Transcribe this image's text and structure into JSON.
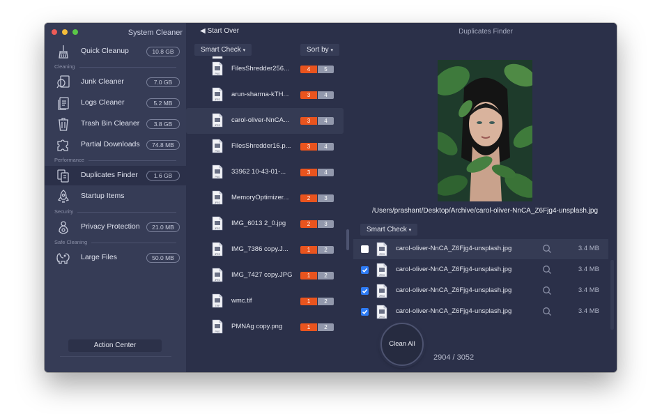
{
  "app": {
    "title": "System Cleaner",
    "window_title": "Duplicates Finder"
  },
  "sidebar": {
    "items": [
      {
        "label": "Quick Cleanup",
        "size": "10.8 GB",
        "icon": "broom-icon"
      },
      {
        "label": "Junk Cleaner",
        "size": "7.0 GB",
        "icon": "magnifier-doc-icon"
      },
      {
        "label": "Logs Cleaner",
        "size": "5.2 MB",
        "icon": "log-files-icon"
      },
      {
        "label": "Trash Bin Cleaner",
        "size": "3.8 GB",
        "icon": "trash-icon"
      },
      {
        "label": "Partial Downloads",
        "size": "74.8 MB",
        "icon": "puzzle-icon"
      },
      {
        "label": "Duplicates Finder",
        "size": "1.6 GB",
        "icon": "duplicate-files-icon"
      },
      {
        "label": "Startup Items",
        "size": "",
        "icon": "rocket-icon"
      },
      {
        "label": "Privacy Protection",
        "size": "21.0 MB",
        "icon": "privacy-icon"
      },
      {
        "label": "Large Files",
        "size": "50.0 MB",
        "icon": "elephant-icon"
      }
    ],
    "sections": [
      "Cleaning",
      "Performance",
      "Security",
      "Safe Cleaning"
    ],
    "action_center": "Action Center"
  },
  "toolbar": {
    "back": "Start Over",
    "smart_check": "Smart Check",
    "sort_by": "Sort by"
  },
  "file_list": [
    {
      "name": "FilesShredder256...",
      "a": "4",
      "b": "5",
      "type": "PNG"
    },
    {
      "name": "arun-sharma-kTH...",
      "a": "3",
      "b": "4",
      "type": "JPEG"
    },
    {
      "name": "carol-oliver-NnCA...",
      "a": "3",
      "b": "4",
      "type": "JPEG"
    },
    {
      "name": "FilesShredder16.p...",
      "a": "3",
      "b": "4",
      "type": "PNG"
    },
    {
      "name": "33962 10-43-01-...",
      "a": "3",
      "b": "4",
      "type": "PNG"
    },
    {
      "name": "MemoryOptimizer...",
      "a": "2",
      "b": "3",
      "type": "JPEG"
    },
    {
      "name": "IMG_6013 2_0.jpg",
      "a": "2",
      "b": "3",
      "type": "JPEG"
    },
    {
      "name": "IMG_7386 copy.J...",
      "a": "1",
      "b": "2",
      "type": "JPEG"
    },
    {
      "name": "IMG_7427 copy.JPG",
      "a": "1",
      "b": "2",
      "type": "JPEG"
    },
    {
      "name": "wmc.tif",
      "a": "1",
      "b": "2",
      "type": "TIFF"
    },
    {
      "name": "PMNAg copy.png",
      "a": "1",
      "b": "2",
      "type": "PNG"
    }
  ],
  "detail": {
    "path": "/Users/prashant/Desktop/Archive/carol-oliver-NnCA_Z6Fjg4-unsplash.jpg",
    "smart_check": "Smart Check",
    "duplicates": [
      {
        "name": "carol-oliver-NnCA_Z6Fjg4-unsplash.jpg",
        "size": "3.4 MB",
        "checked": false
      },
      {
        "name": "carol-oliver-NnCA_Z6Fjg4-unsplash.jpg",
        "size": "3.4 MB",
        "checked": true
      },
      {
        "name": "carol-oliver-NnCA_Z6Fjg4-unsplash.jpg",
        "size": "3.4 MB",
        "checked": true
      },
      {
        "name": "carol-oliver-NnCA_Z6Fjg4-unsplash.jpg",
        "size": "3.4 MB",
        "checked": true
      }
    ],
    "clean_all": "Clean All",
    "count": "2904 / 3052"
  },
  "colors": {
    "accent_orange": "#e9541e",
    "checkbox_blue": "#2e7cf6",
    "sidebar_bg": "#363c56",
    "panel_bg": "#2b3049"
  }
}
